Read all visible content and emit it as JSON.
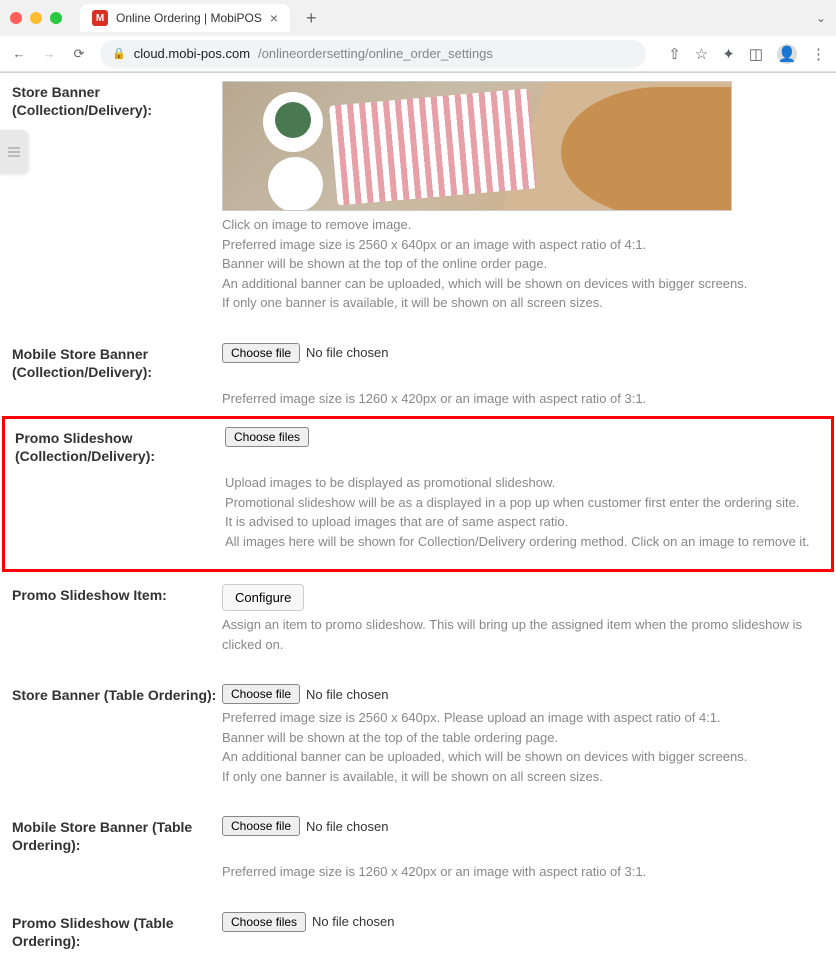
{
  "browser": {
    "tab_title": "Online Ordering | MobiPOS",
    "favicon_letter": "M",
    "url_host": "cloud.mobi-pos.com",
    "url_path": "/onlineordersetting/online_order_settings"
  },
  "sections": {
    "store_banner": {
      "label": "Store Banner (Collection/Delivery):",
      "help1": "Click on image to remove image.",
      "help2": "Preferred image size is 2560 x 640px or an image with aspect ratio of 4:1.",
      "help3": "Banner will be shown at the top of the online order page.",
      "help4": "An additional banner can be uploaded, which will be shown on devices with bigger screens.",
      "help5": "If only one banner is available, it will be shown on all screen sizes."
    },
    "mobile_banner": {
      "label": "Mobile Store Banner (Collection/Delivery):",
      "file_btn": "Choose file",
      "file_status": "No file chosen",
      "help1": "Preferred image size is 1260 x 420px or an image with aspect ratio of 3:1."
    },
    "promo_slideshow": {
      "label": "Promo Slideshow (Collection/Delivery):",
      "file_btn": "Choose files",
      "help1": "Upload images to be displayed as promotional slideshow.",
      "help2": "Promotional slideshow will be as a displayed in a pop up when customer first enter the ordering site.",
      "help3": "It is advised to upload images that are of same aspect ratio.",
      "help4": "All images here will be shown for Collection/Delivery ordering method. Click on an image to remove it."
    },
    "promo_item": {
      "label": "Promo Slideshow Item:",
      "btn": "Configure",
      "help1": "Assign an item to promo slideshow. This will bring up the assigned item when the promo slideshow is clicked on."
    },
    "table_banner": {
      "label": "Store Banner (Table Ordering):",
      "file_btn": "Choose file",
      "file_status": "No file chosen",
      "help1": "Preferred image size is 2560 x 640px. Please upload an image with aspect ratio of 4:1.",
      "help2": "Banner will be shown at the top of the table ordering page.",
      "help3": "An additional banner can be uploaded, which will be shown on devices with bigger screens.",
      "help4": "If only one banner is available, it will be shown on all screen sizes."
    },
    "table_mobile_banner": {
      "label": "Mobile Store Banner (Table Ordering):",
      "file_btn": "Choose file",
      "file_status": "No file chosen",
      "help1": "Preferred image size is 1260 x 420px or an image with aspect ratio of 3:1."
    },
    "table_promo": {
      "label": "Promo Slideshow (Table Ordering):",
      "file_btn": "Choose files",
      "file_status": "No file chosen"
    }
  }
}
